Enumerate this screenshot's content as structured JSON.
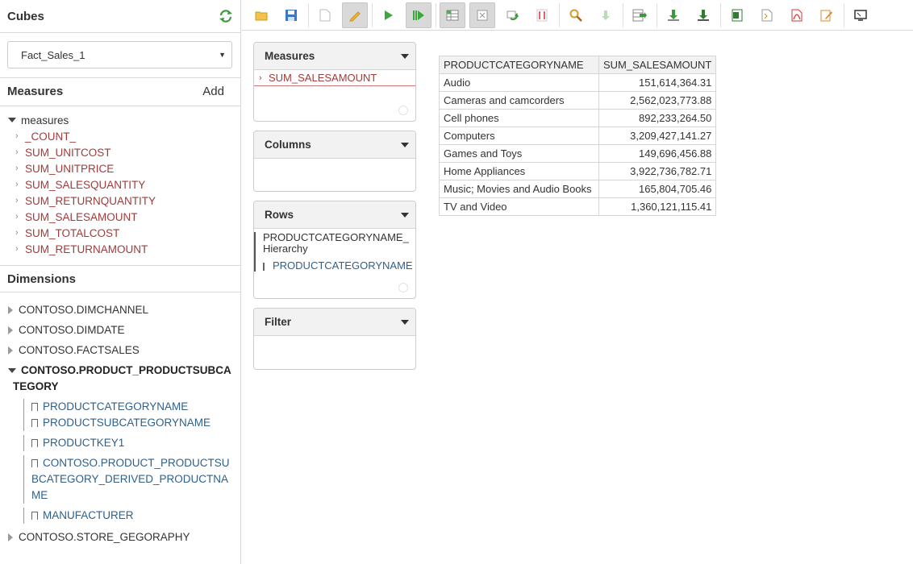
{
  "cubes": {
    "title": "Cubes",
    "selected": "Fact_Sales_1"
  },
  "measures": {
    "title": "Measures",
    "add_label": "Add",
    "root": "measures",
    "items": [
      "_COUNT_",
      "SUM_UNITCOST",
      "SUM_UNITPRICE",
      "SUM_SALESQUANTITY",
      "SUM_RETURNQUANTITY",
      "SUM_SALESAMOUNT",
      "SUM_TOTALCOST",
      "SUM_RETURNAMOUNT"
    ]
  },
  "dimensions": {
    "title": "Dimensions",
    "collapsed_top": [
      "CONTOSO.DIMCHANNEL",
      "CONTOSO.DIMDATE",
      "CONTOSO.FACTSALES"
    ],
    "expanded": {
      "label": "CONTOSO.PRODUCT_PRODUCTSUBCATEGORY",
      "attributes": [
        "PRODUCTCATEGORYNAME",
        "PRODUCTSUBCATEGORYNAME",
        "PRODUCTKEY1",
        "CONTOSO.PRODUCT_PRODUCTSUBCATEGORY_DERIVED_PRODUCTNAME",
        "MANUFACTURER"
      ]
    },
    "collapsed_bottom": [
      "CONTOSO.STORE_GEGORAPHY"
    ]
  },
  "toolbar": {
    "buttons": [
      "open-folder",
      "save",
      "new",
      "edit",
      "run",
      "run-all",
      "table-view",
      "hide-empty",
      "refresh-query",
      "formula",
      "search",
      "drill-down",
      "export",
      "download-csv",
      "download-all",
      "excel",
      "document",
      "pdf",
      "report",
      "present"
    ]
  },
  "panels": {
    "measures": {
      "title": "Measures",
      "items": [
        "SUM_SALESAMOUNT"
      ]
    },
    "columns": {
      "title": "Columns"
    },
    "rows": {
      "title": "Rows",
      "hierarchy": "PRODUCTCATEGORYNAME_Hierarchy",
      "level": "PRODUCTCATEGORYNAME"
    },
    "filter": {
      "title": "Filter"
    }
  },
  "result": {
    "headers": [
      "PRODUCTCATEGORYNAME",
      "SUM_SALESAMOUNT"
    ],
    "rows": [
      [
        "Audio",
        "151,614,364.31"
      ],
      [
        "Cameras and camcorders",
        "2,562,023,773.88"
      ],
      [
        "Cell phones",
        "892,233,264.50"
      ],
      [
        "Computers",
        "3,209,427,141.27"
      ],
      [
        "Games and Toys",
        "149,696,456.88"
      ],
      [
        "Home Appliances",
        "3,922,736,782.71"
      ],
      [
        "Music; Movies and Audio Books",
        "165,804,705.46"
      ],
      [
        "TV and Video",
        "1,360,121,115.41"
      ]
    ]
  },
  "colors": {
    "measure_text": "#a33a3a",
    "attribute_text": "#2f5f8a",
    "panel_header": "#f2f2f2"
  }
}
